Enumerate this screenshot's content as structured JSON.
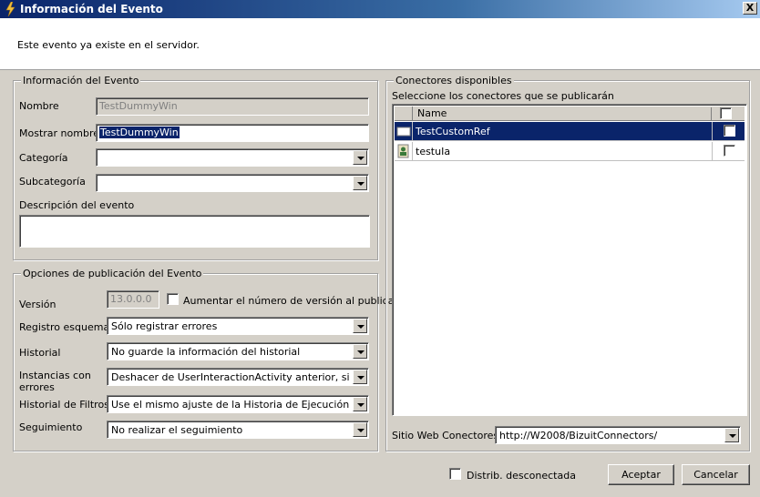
{
  "window": {
    "title": "Información del Evento",
    "close_label": "X"
  },
  "header": {
    "message": "Este evento ya existe en el servidor."
  },
  "event_info": {
    "legend": "Información del Evento",
    "name_label": "Nombre",
    "name_value": "TestDummyWin",
    "display_name_label": "Mostrar nombre",
    "display_name_value": "TestDummyWin",
    "category_label": "Categoría",
    "category_value": "",
    "subcategory_label": "Subcategoría",
    "subcategory_value": "",
    "description_label": "Descripción del evento",
    "description_value": ""
  },
  "publish_options": {
    "legend": "Opciones de publicación del Evento",
    "version_label": "Versión",
    "version_value": "13.0.0.0",
    "increase_version_label": "Aumentar el número de versión al publicar",
    "schema_log_label": "Registro esquema",
    "schema_log_value": "Sólo registrar errores",
    "history_label": "Historial",
    "history_value": "No guarde la información del historial",
    "error_instances_label": "Instancias con errores",
    "error_instances_value": "Deshacer de UserInteractionActivity anterior, si está disponible",
    "filter_history_label": "Historial de Filtros",
    "filter_history_value": "Use el mismo ajuste de la Historia de Ejecución",
    "tracking_label": "Seguimiento",
    "tracking_value": "No realizar el seguimiento"
  },
  "connectors": {
    "legend": "Conectores disponibles",
    "instruction": "Seleccione los conectores que se publicarán",
    "column_name": "Name",
    "rows": [
      {
        "name": "TestCustomRef",
        "selected": true
      },
      {
        "name": "testuIa",
        "selected": false
      }
    ],
    "website_label": "Sitio Web Conectores:",
    "website_value": "http://W2008/BizuitConnectors/"
  },
  "footer": {
    "disconnected_label": "Distrib. desconectada",
    "accept_label": "Aceptar",
    "cancel_label": "Cancelar"
  }
}
